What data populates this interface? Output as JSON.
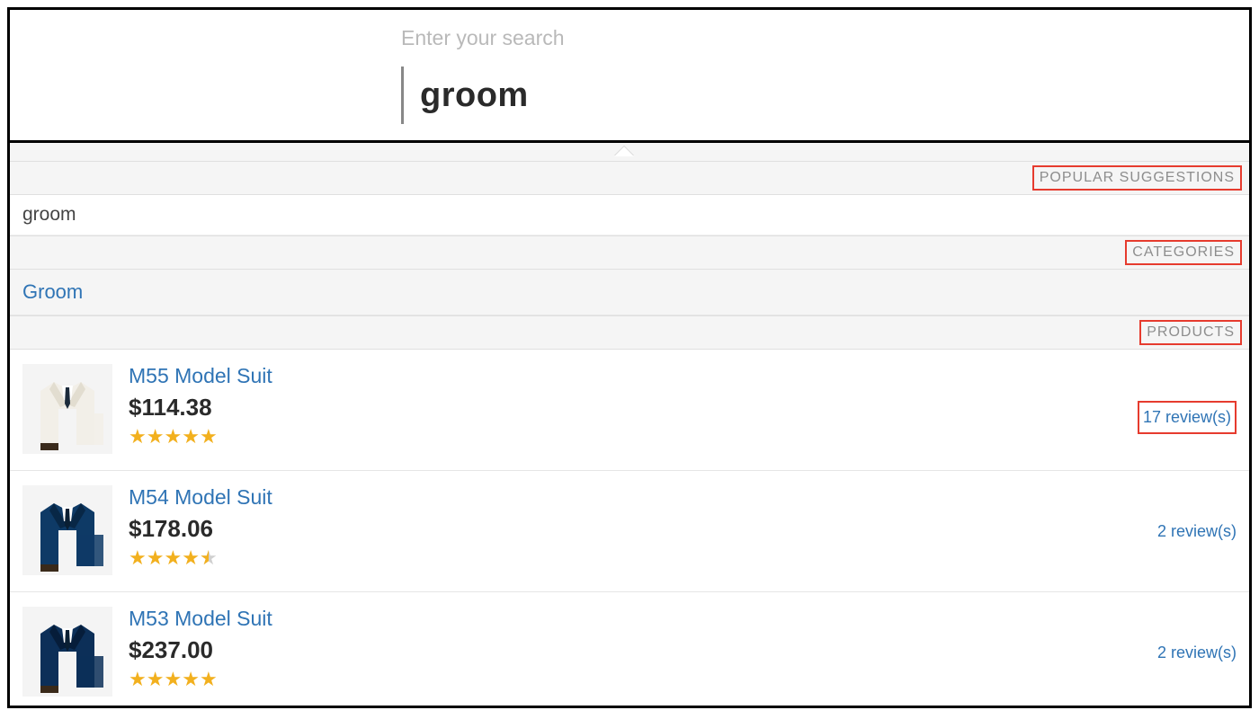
{
  "search": {
    "placeholder": "Enter your search",
    "value": "groom"
  },
  "sections": {
    "popular_suggestions_label": "POPULAR SUGGESTIONS",
    "categories_label": "CATEGORIES",
    "products_label": "PRODUCTS"
  },
  "suggestions": [
    {
      "text": "groom"
    }
  ],
  "categories": [
    {
      "text": "Groom"
    }
  ],
  "products": [
    {
      "name": "M55 Model Suit",
      "price": "$114.38",
      "rating": 5,
      "reviews": "17 review(s)",
      "reviews_highlighted": true,
      "thumb_colors": {
        "jacket": "#f2efe8",
        "lapel": "#e2ddd0",
        "shirt": "#ffffff",
        "tie": "#1b2a3a"
      }
    },
    {
      "name": "M54 Model Suit",
      "price": "$178.06",
      "rating": 4.5,
      "reviews": "2 review(s)",
      "reviews_highlighted": false,
      "thumb_colors": {
        "jacket": "#0e3a66",
        "lapel": "#082746",
        "shirt": "#ffffff",
        "tie": "#0a1f33"
      }
    },
    {
      "name": "M53 Model Suit",
      "price": "$237.00",
      "rating": 5,
      "reviews": "2 review(s)",
      "reviews_highlighted": false,
      "thumb_colors": {
        "jacket": "#0c2f58",
        "lapel": "#061d3a",
        "shirt": "#ffffff",
        "tie": "#0a1f33"
      }
    }
  ]
}
